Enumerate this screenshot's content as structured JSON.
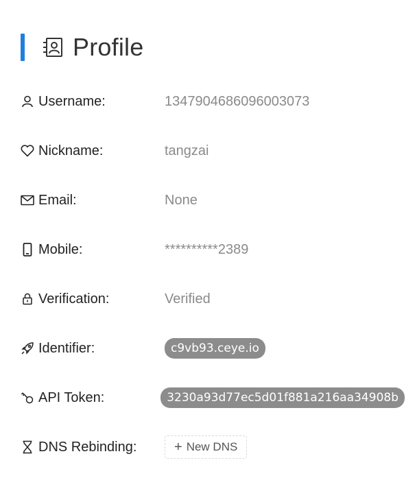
{
  "header": {
    "title": "Profile",
    "accent_color": "#1f7fe0",
    "icon": "contact-card-icon"
  },
  "rows": [
    {
      "label": "Username:",
      "value": "1347904686096003073",
      "icon": "user-icon"
    },
    {
      "label": "Nickname:",
      "value": "tangzai",
      "icon": "heart-icon"
    },
    {
      "label": "Email:",
      "value": "None",
      "icon": "mail-icon"
    },
    {
      "label": "Mobile:",
      "value": "**********2389",
      "icon": "mobile-icon"
    },
    {
      "label": "Verification:",
      "value": "Verified",
      "icon": "lock-icon"
    },
    {
      "label": "Identifier:",
      "value": "c9vb93.ceye.io",
      "icon": "rocket-icon"
    },
    {
      "label": "API Token:",
      "value": "3230a93d77ec5d01f881a216aa34908b",
      "icon": "key-icon"
    },
    {
      "label": "DNS Rebinding:",
      "value": "New DNS",
      "icon": "hourglass-icon"
    }
  ],
  "colors": {
    "value_text": "#8a8a8a",
    "pill_bg": "#8c8c8c"
  }
}
